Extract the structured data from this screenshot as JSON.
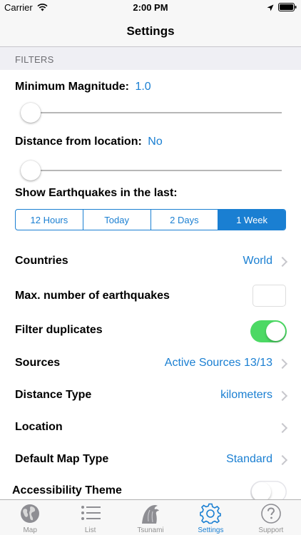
{
  "status_bar": {
    "carrier": "Carrier",
    "time": "2:00 PM"
  },
  "nav": {
    "title": "Settings"
  },
  "filters": {
    "section_header": "FILTERS",
    "min_magnitude": {
      "label": "Minimum Magnitude:",
      "value": "1.0",
      "slider_level": 0
    },
    "distance": {
      "label": "Distance from location:",
      "value": "No",
      "slider_level": 0
    },
    "show_last": {
      "label": "Show Earthquakes in the last:",
      "options": [
        "12 Hours",
        "Today",
        "2 Days",
        "1 Week"
      ],
      "selected": "1 Week"
    }
  },
  "rows": {
    "countries": {
      "label": "Countries",
      "value": "World"
    },
    "max_number": {
      "label": "Max. number of earthquakes",
      "value": ""
    },
    "filter_duplicates": {
      "label": "Filter duplicates",
      "on": true
    },
    "sources": {
      "label": "Sources",
      "value": "Active Sources 13/13"
    },
    "distance_type": {
      "label": "Distance Type",
      "value": "kilometers"
    },
    "location": {
      "label": "Location"
    },
    "default_map_type": {
      "label": "Default Map Type",
      "value": "Standard"
    },
    "accessibility_theme": {
      "label": "Accessibility Theme",
      "on": false
    }
  },
  "tabbar": {
    "tabs": [
      {
        "label": "Map",
        "icon": "globe-icon",
        "active": false
      },
      {
        "label": "List",
        "icon": "list-icon",
        "active": false
      },
      {
        "label": "Tsunami",
        "icon": "tsunami-wave-icon",
        "active": false
      },
      {
        "label": "Settings",
        "icon": "gear-icon",
        "active": true
      },
      {
        "label": "Support",
        "icon": "help-icon",
        "active": false
      }
    ]
  },
  "colors": {
    "accent": "#1a7fd2",
    "switch_on": "#4cd964",
    "background": "#efeff4"
  }
}
